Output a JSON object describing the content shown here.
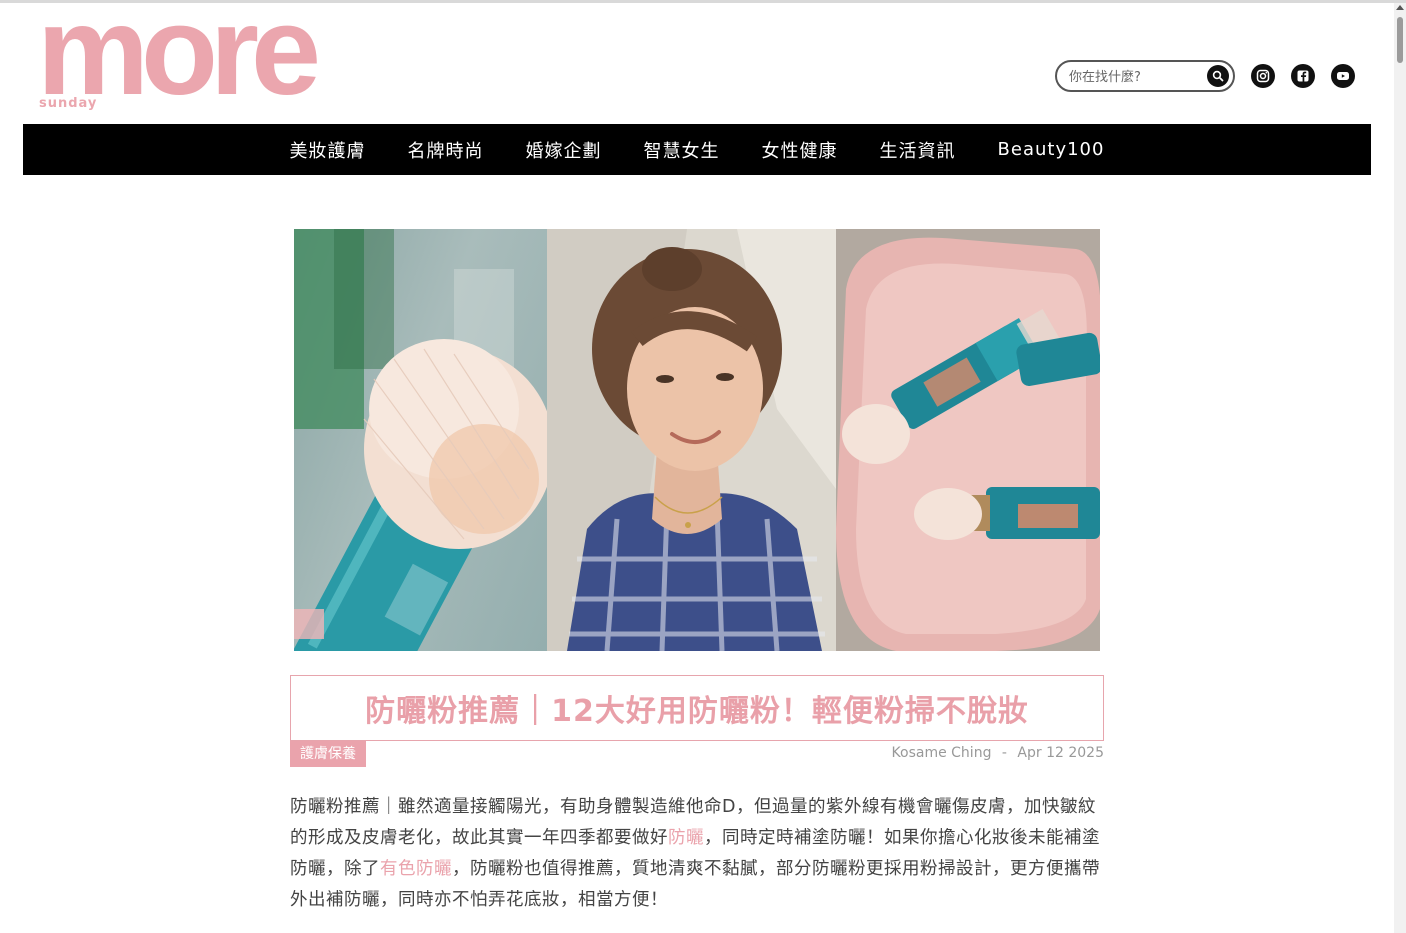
{
  "logo": {
    "word": "more",
    "sub": "sunday"
  },
  "search": {
    "placeholder": "你在找什麼?"
  },
  "nav": {
    "items": [
      "美妝護膚",
      "名牌時尚",
      "婚嫁企劃",
      "智慧女生",
      "女性健康",
      "生活資訊",
      "Beauty100"
    ]
  },
  "article": {
    "title": "防曬粉推薦｜12大好用防曬粉！輕便粉掃不脫妝",
    "category": "護膚保養",
    "author": "Kosame Ching",
    "separator": "-",
    "date": "Apr 12 2025",
    "intro": {
      "p1": "防曬粉推薦｜雖然適量接觸陽光，有助身體製造維他命D，但過量的紫外線有機會曬傷皮膚，加快皺紋的形成及皮膚老化，故此其實一年四季都要做好",
      "link1": "防曬",
      "p2": "，同時定時補塗防曬！如果你擔心化妝後未能補塗防曬，除了",
      "link2": "有色防曬",
      "p3": "，防曬粉也值得推薦，質地清爽不黏膩，部分防曬粉更採用粉掃設計，更方便攜帶外出補防曬，同時亦不怕弄花底妝，相當方便！"
    }
  },
  "colors": {
    "brand_pink": "#eba6ae",
    "nav_bg": "#000000"
  }
}
